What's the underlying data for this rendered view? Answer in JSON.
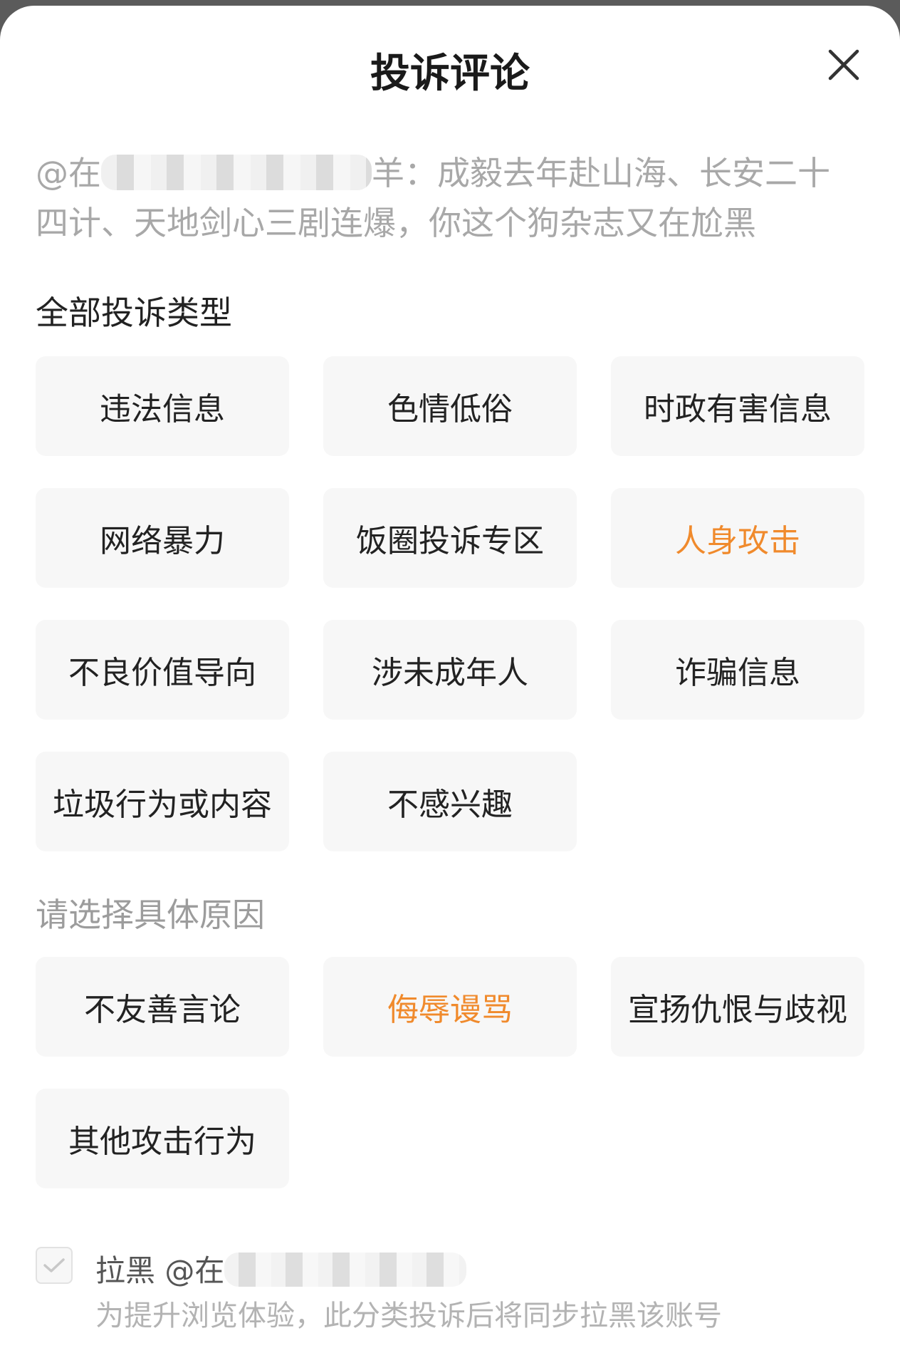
{
  "dialog": {
    "title": "投诉评论",
    "close_icon": "close-icon",
    "comment": {
      "prefix": "@在",
      "text": "羊：成毅去年赴山海、长安二十四计、天地剑心三剧连爆，你这个狗杂志又在尬黑"
    },
    "section_all_types": "全部投诉类型",
    "types": [
      {
        "label": "违法信息",
        "selected": false
      },
      {
        "label": "色情低俗",
        "selected": false
      },
      {
        "label": "时政有害信息",
        "selected": false
      },
      {
        "label": "网络暴力",
        "selected": false
      },
      {
        "label": "饭圈投诉专区",
        "selected": false
      },
      {
        "label": "人身攻击",
        "selected": true
      },
      {
        "label": "不良价值导向",
        "selected": false
      },
      {
        "label": "涉未成年人",
        "selected": false
      },
      {
        "label": "诈骗信息",
        "selected": false
      },
      {
        "label": "垃圾行为或内容",
        "selected": false
      },
      {
        "label": "不感兴趣",
        "selected": false
      }
    ],
    "section_reason": "请选择具体原因",
    "reasons": [
      {
        "label": "不友善言论",
        "selected": false
      },
      {
        "label": "侮辱谩骂",
        "selected": true
      },
      {
        "label": "宣扬仇恨与歧视",
        "selected": false
      },
      {
        "label": "其他攻击行为",
        "selected": false
      }
    ],
    "block": {
      "label_prefix": "拉黑 @在",
      "checked": true,
      "note": "为提升浏览体验，此分类投诉后将同步拉黑该账号"
    }
  },
  "colors": {
    "accent": "#f08a2c",
    "chip_bg": "#f7f7f7",
    "muted_text": "#a8a8a8"
  }
}
